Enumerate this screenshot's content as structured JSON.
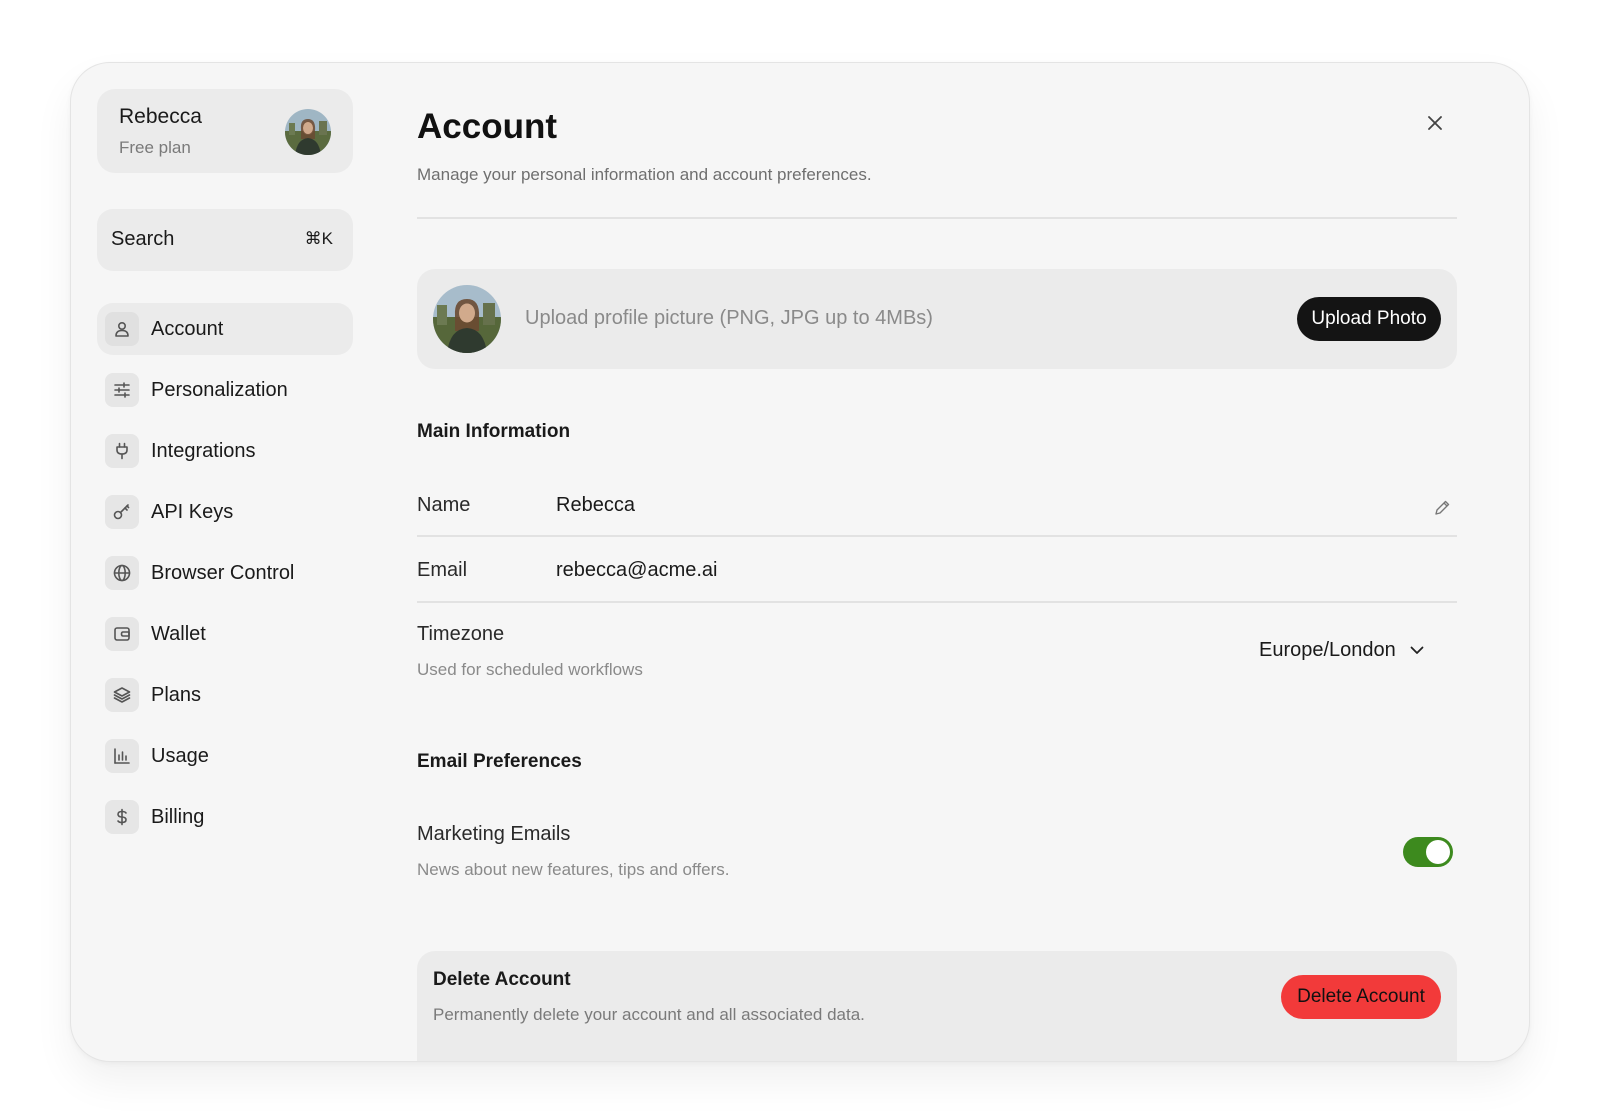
{
  "user": {
    "name": "Rebecca",
    "plan": "Free plan"
  },
  "search": {
    "label": "Search",
    "shortcut": "⌘K"
  },
  "sidebar": {
    "items": [
      {
        "label": "Account",
        "icon": "user-icon",
        "active": true
      },
      {
        "label": "Personalization",
        "icon": "sliders-icon",
        "active": false
      },
      {
        "label": "Integrations",
        "icon": "plug-icon",
        "active": false
      },
      {
        "label": "API Keys",
        "icon": "key-icon",
        "active": false
      },
      {
        "label": "Browser Control",
        "icon": "globe-icon",
        "active": false
      },
      {
        "label": "Wallet",
        "icon": "wallet-icon",
        "active": false
      },
      {
        "label": "Plans",
        "icon": "layers-icon",
        "active": false
      },
      {
        "label": "Usage",
        "icon": "bar-chart-icon",
        "active": false
      },
      {
        "label": "Billing",
        "icon": "dollar-icon",
        "active": false
      }
    ]
  },
  "header": {
    "title": "Account",
    "subtitle": "Manage your personal information and account preferences."
  },
  "upload": {
    "text": "Upload profile picture (PNG, JPG up to 4MBs)",
    "button": "Upload Photo"
  },
  "main_info": {
    "title": "Main Information",
    "name_label": "Name",
    "name_value": "Rebecca",
    "email_label": "Email",
    "email_value": "rebecca@acme.ai",
    "timezone_label": "Timezone",
    "timezone_sub": "Used for scheduled workflows",
    "timezone_value": "Europe/London"
  },
  "email_prefs": {
    "title": "Email Preferences",
    "marketing_label": "Marketing Emails",
    "marketing_sub": "News about new features, tips and offers.",
    "marketing_enabled": true
  },
  "delete": {
    "title": "Delete Account",
    "subtitle": "Permanently delete your account and all associated data.",
    "button": "Delete Account"
  },
  "colors": {
    "toggle_on": "#3d8a1e",
    "danger": "#f23a3a",
    "primary_button": "#141414"
  }
}
